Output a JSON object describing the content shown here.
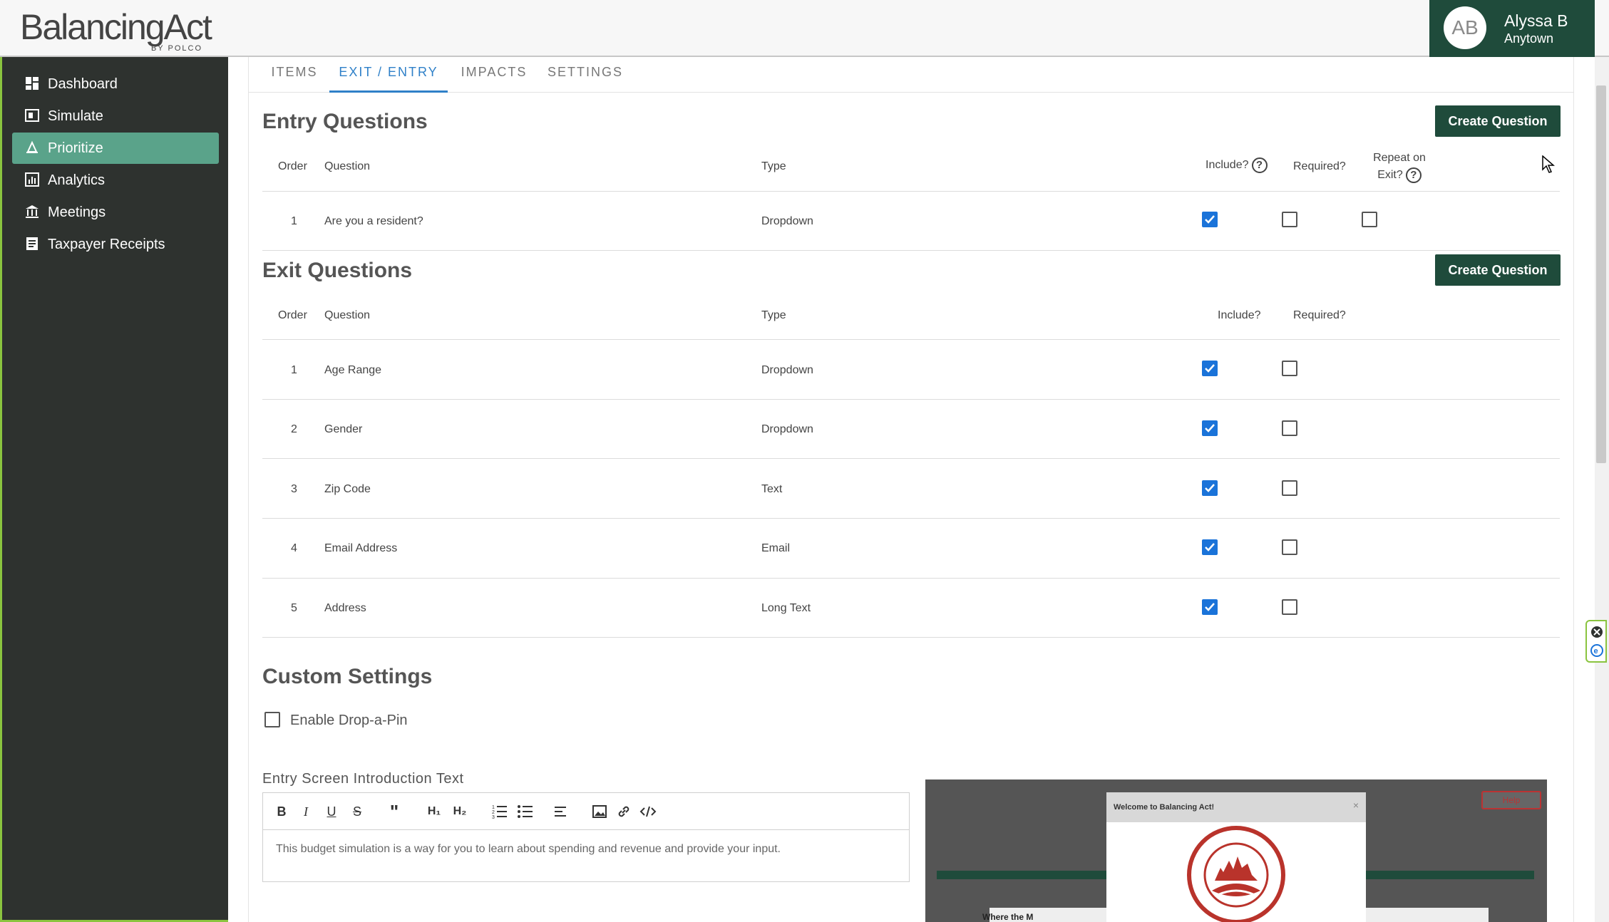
{
  "header": {
    "logo_text": "BalancingAct",
    "logo_sub": "BY POLCO",
    "user": {
      "initials": "AB",
      "name": "Alyssa B",
      "town": "Anytown"
    }
  },
  "sidebar": {
    "items": [
      {
        "label": "Dashboard",
        "icon": "dashboard-icon"
      },
      {
        "label": "Simulate",
        "icon": "simulate-icon"
      },
      {
        "label": "Prioritize",
        "icon": "prioritize-icon",
        "active": true
      },
      {
        "label": "Analytics",
        "icon": "analytics-icon"
      },
      {
        "label": "Meetings",
        "icon": "meetings-icon"
      },
      {
        "label": "Taxpayer Receipts",
        "icon": "receipt-icon"
      }
    ]
  },
  "tabs": [
    {
      "label": "ITEMS"
    },
    {
      "label": "EXIT / ENTRY",
      "active": true
    },
    {
      "label": "IMPACTS"
    },
    {
      "label": "SETTINGS"
    }
  ],
  "entry": {
    "title": "Entry Questions",
    "create_label": "Create Question",
    "headers": {
      "order": "Order",
      "question": "Question",
      "type": "Type",
      "include": "Include?",
      "required": "Required?",
      "repeat_line1": "Repeat on",
      "repeat_line2": "Exit?"
    },
    "rows": [
      {
        "order": "1",
        "question": "Are you a resident?",
        "type": "Dropdown",
        "include": true,
        "required": false,
        "repeat": false
      }
    ]
  },
  "exit": {
    "title": "Exit Questions",
    "create_label": "Create Question",
    "headers": {
      "order": "Order",
      "question": "Question",
      "type": "Type",
      "include": "Include?",
      "required": "Required?"
    },
    "rows": [
      {
        "order": "1",
        "question": "Age Range",
        "type": "Dropdown",
        "include": true,
        "required": false
      },
      {
        "order": "2",
        "question": "Gender",
        "type": "Dropdown",
        "include": true,
        "required": false
      },
      {
        "order": "3",
        "question": "Zip Code",
        "type": "Text",
        "include": true,
        "required": false
      },
      {
        "order": "4",
        "question": "Email Address",
        "type": "Email",
        "include": true,
        "required": false
      },
      {
        "order": "5",
        "question": "Address",
        "type": "Long Text",
        "include": true,
        "required": false
      }
    ]
  },
  "custom": {
    "title": "Custom Settings",
    "drop_pin_label": "Enable Drop-a-Pin",
    "drop_pin_checked": false,
    "intro_label": "Entry Screen Introduction Text",
    "intro_text": "This budget simulation is a way for you to learn about spending and revenue and provide your input."
  },
  "preview": {
    "help_label": "Help",
    "modal_title": "Welcome to Balancing Act!",
    "close_glyph": "×",
    "bottom_text": "Where the M"
  },
  "colors": {
    "accent": "#1f4b3b",
    "active_nav": "#5aa38a",
    "tab_active": "#2f80c8",
    "checkbox": "#1a73d9",
    "border_green": "#8ac43f"
  }
}
